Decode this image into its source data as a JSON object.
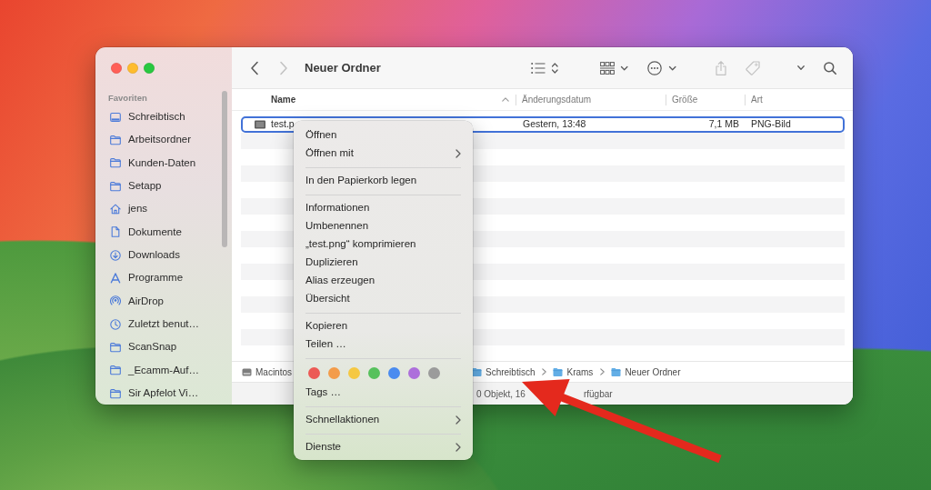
{
  "toolbar": {
    "navigation": [
      {
        "kind": "back",
        "disabled": false
      },
      {
        "kind": "forward",
        "disabled": true
      }
    ],
    "title": "Neuer Ordner",
    "buttons": [
      {
        "kind": "view",
        "disabled": false
      },
      {
        "kind": "group",
        "disabled": false
      },
      {
        "kind": "action",
        "disabled": false
      },
      {
        "kind": "share",
        "disabled": true
      },
      {
        "kind": "tags",
        "disabled": true
      },
      {
        "kind": "more",
        "disabled": false
      },
      {
        "kind": "search",
        "disabled": false
      }
    ]
  },
  "sidebar": {
    "heading": "Favoriten",
    "items": [
      {
        "label": "Schreibtisch",
        "kind": "desktop",
        "selected": false
      },
      {
        "label": "Arbeitsordner",
        "kind": "folder",
        "selected": false
      },
      {
        "label": "Kunden-Daten",
        "kind": "folder",
        "selected": false
      },
      {
        "label": "Setapp",
        "kind": "folder",
        "selected": false
      },
      {
        "label": "jens",
        "kind": "home",
        "selected": false
      },
      {
        "label": "Dokumente",
        "kind": "document",
        "selected": false
      },
      {
        "label": "Downloads",
        "kind": "download",
        "selected": false
      },
      {
        "label": "Programme",
        "kind": "apps",
        "selected": false
      },
      {
        "label": "AirDrop",
        "kind": "airdrop",
        "selected": false
      },
      {
        "label": "Zuletzt benut…",
        "kind": "clock",
        "selected": false
      },
      {
        "label": "ScanSnap",
        "kind": "folder",
        "selected": false
      },
      {
        "label": "_Ecamm-Auf…",
        "kind": "folder",
        "selected": false
      },
      {
        "label": "Sir Apfelot Vi…",
        "kind": "folder",
        "selected": false
      }
    ]
  },
  "table": {
    "columns": [
      {
        "label": "Name",
        "sorted": true
      },
      {
        "label": "Änderungsdatum",
        "sorted": false
      },
      {
        "label": "Größe",
        "sorted": false
      },
      {
        "label": "Art",
        "sorted": false
      }
    ],
    "rows": [
      {
        "cells": [
          "test.p",
          "Gestern, 13:48",
          "7,1 MB",
          "PNG-Bild"
        ],
        "selected": true
      }
    ]
  },
  "path_bar": [
    {
      "label": "Macintos",
      "kind": "disk"
    },
    {
      "label": "Schreibtisch",
      "kind": "folder"
    },
    {
      "label": "Krams",
      "kind": "folder"
    },
    {
      "label": "Neuer Ordner",
      "kind": "folder"
    }
  ],
  "status_bar": [
    "0 Objekt, 16",
    "rfügbar"
  ],
  "context_menu": {
    "items": [
      {
        "kind": "item",
        "label": "Öffnen",
        "submenu": false
      },
      {
        "kind": "item",
        "label": "Öffnen mit",
        "submenu": true
      },
      {
        "kind": "separator"
      },
      {
        "kind": "item",
        "label": "In den Papierkorb legen",
        "submenu": false
      },
      {
        "kind": "separator"
      },
      {
        "kind": "item",
        "label": "Informationen",
        "submenu": false
      },
      {
        "kind": "item",
        "label": "Umbenennen",
        "submenu": false
      },
      {
        "kind": "item",
        "label": "„test.png“ komprimieren",
        "submenu": false
      },
      {
        "kind": "item",
        "label": "Duplizieren",
        "submenu": false
      },
      {
        "kind": "item",
        "label": "Alias erzeugen",
        "submenu": false
      },
      {
        "kind": "item",
        "label": "Übersicht",
        "submenu": false
      },
      {
        "kind": "separator"
      },
      {
        "kind": "item",
        "label": "Kopieren",
        "submenu": false
      },
      {
        "kind": "item",
        "label": "Teilen …",
        "submenu": false
      },
      {
        "kind": "separator"
      },
      {
        "kind": "tags",
        "tags": [
          {
            "color": "#ec5a55"
          },
          {
            "color": "#f39c4a"
          },
          {
            "color": "#f5c842"
          },
          {
            "color": "#56c15c"
          },
          {
            "color": "#4a8bef"
          },
          {
            "color": "#ad6fdb"
          },
          {
            "color": "#9b9b9b"
          }
        ]
      },
      {
        "kind": "item",
        "label": "Tags …",
        "submenu": false
      },
      {
        "kind": "separator"
      },
      {
        "kind": "item",
        "label": "Schnellaktionen",
        "submenu": true
      },
      {
        "kind": "separator"
      },
      {
        "kind": "item",
        "label": "Dienste",
        "submenu": true
      }
    ]
  },
  "annotations": [
    {
      "kind": "arrow"
    }
  ]
}
